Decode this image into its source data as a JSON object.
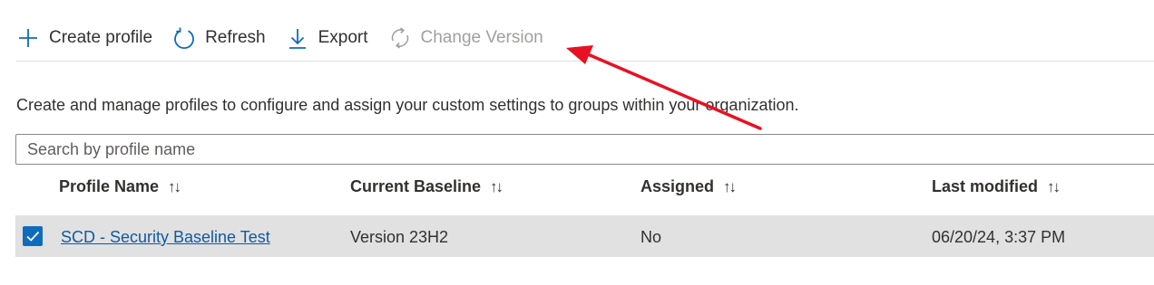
{
  "toolbar": {
    "create_label": "Create profile",
    "refresh_label": "Refresh",
    "export_label": "Export",
    "change_version_label": "Change Version"
  },
  "description": "Create and manage profiles to configure and assign your custom settings to groups within your organization.",
  "search": {
    "placeholder": "Search by profile name",
    "value": ""
  },
  "table": {
    "columns": [
      "Profile Name",
      "Current Baseline",
      "Assigned",
      "Last modified"
    ],
    "sort_glyph": "↑↓",
    "rows": [
      {
        "selected": true,
        "profile_name": "SCD - Security Baseline Test",
        "current_baseline": "Version 23H2",
        "assigned": "No",
        "last_modified": "06/20/24, 3:37 PM"
      }
    ]
  },
  "colors": {
    "accent": "#0f6cbd",
    "disabled": "#a19f9d",
    "annotation_arrow": "#e81123"
  },
  "icons": [
    "add-icon",
    "refresh-icon",
    "download-icon",
    "change-version-icon",
    "checkmark-icon",
    "sort-icon",
    "annotation-arrow"
  ]
}
